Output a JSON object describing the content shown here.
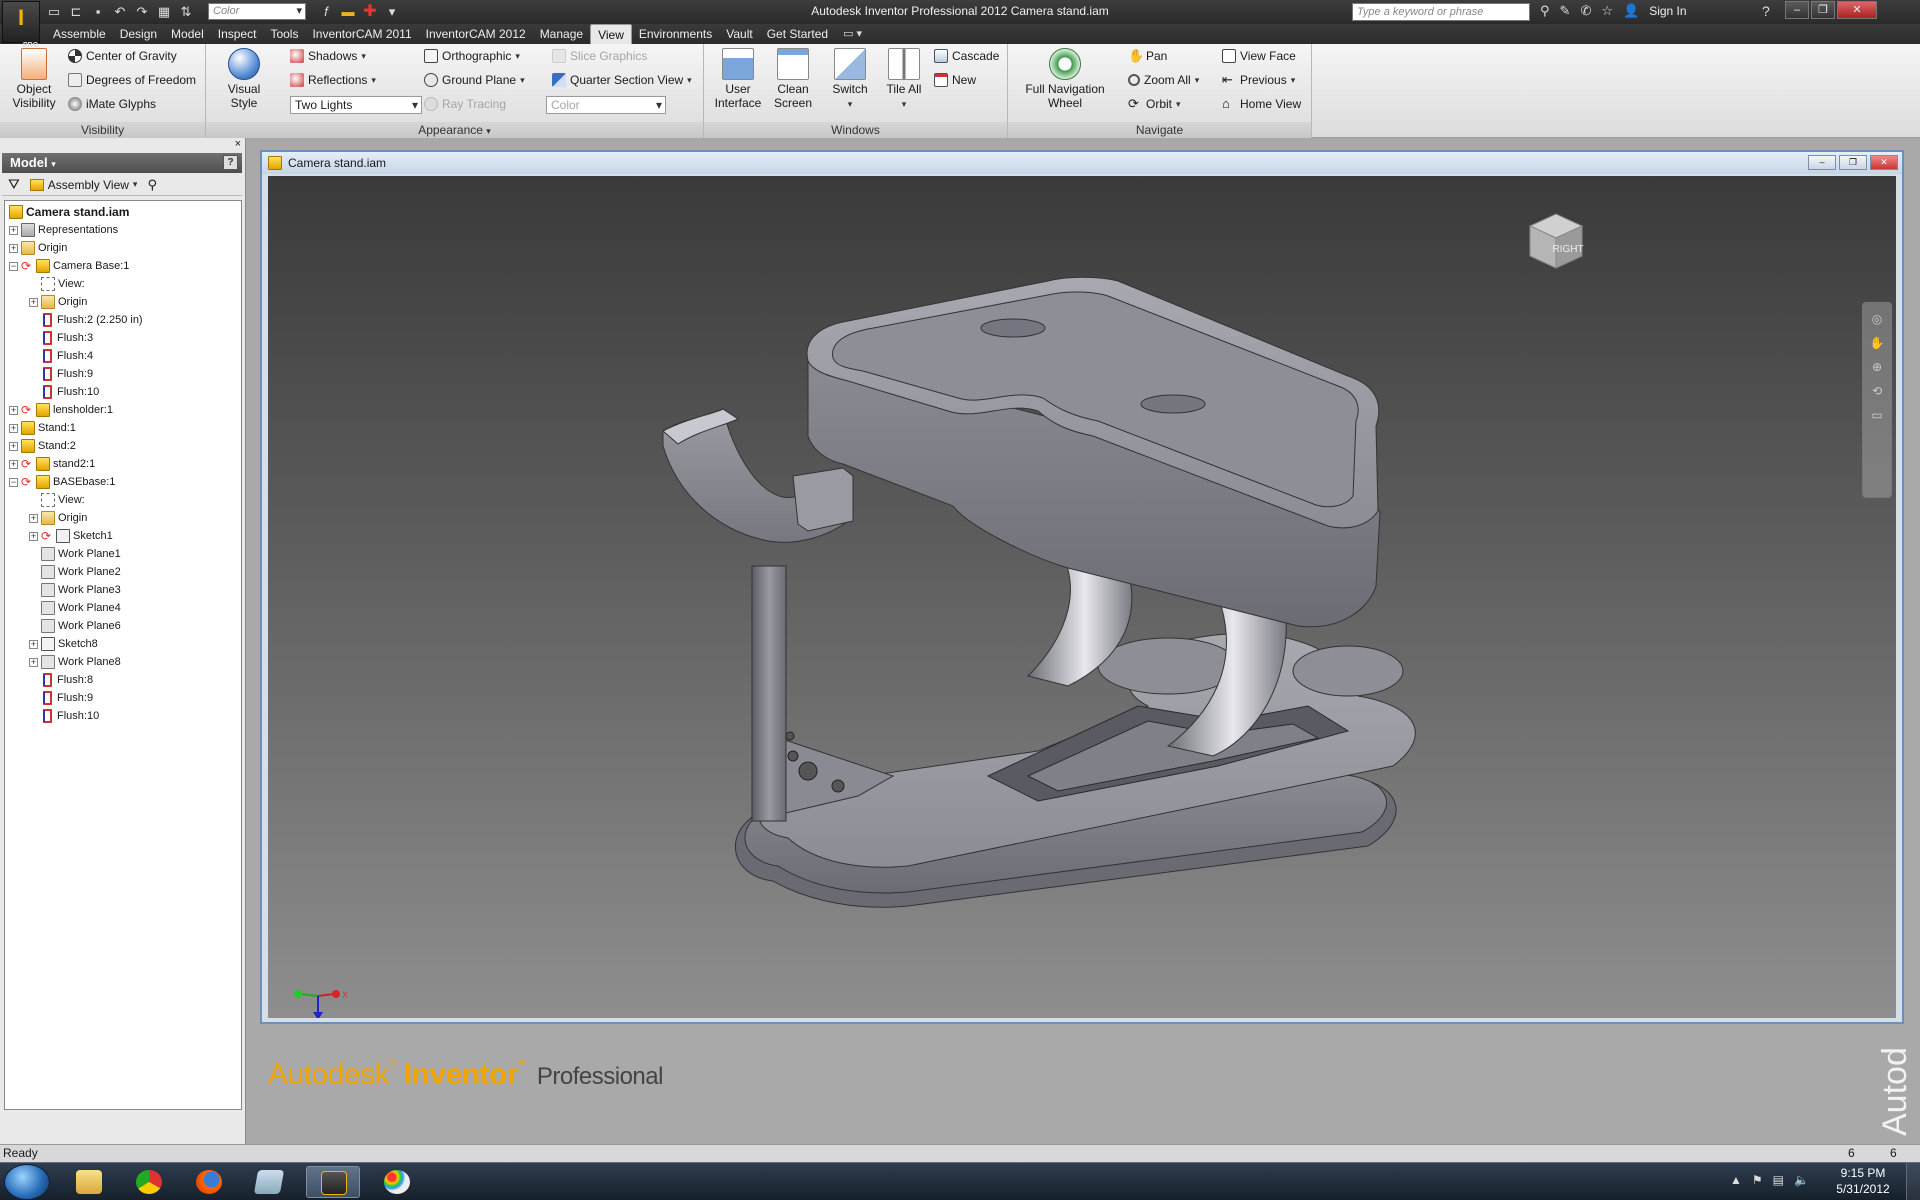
{
  "titlebar": {
    "title": "Autodesk Inventor Professional 2012    Camera stand.iam",
    "logo_text": "I",
    "logo_badge": "PRO",
    "qat_color": "Color",
    "search_placeholder": "Type a keyword or phrase",
    "sign_in": "Sign In"
  },
  "ribbon_tabs": [
    "Assemble",
    "Design",
    "Model",
    "Inspect",
    "Tools",
    "InventorCAM 2011",
    "InventorCAM 2012",
    "Manage",
    "View",
    "Environments",
    "Vault",
    "Get Started"
  ],
  "active_tab": "View",
  "ribbon": {
    "visibility": {
      "label": "Visibility",
      "object_visibility": "Object Visibility",
      "center_of_gravity": "Center of Gravity",
      "degrees_of_freedom": "Degrees of Freedom",
      "imate_glyphs": "iMate Glyphs"
    },
    "appearance": {
      "label": "Appearance",
      "visual_style": "Visual Style",
      "shadows": "Shadows",
      "reflections": "Reflections",
      "lighting": "Two Lights",
      "orthographic": "Orthographic",
      "ground_plane": "Ground Plane",
      "ray_tracing": "Ray Tracing",
      "slice_graphics": "Slice Graphics",
      "quarter_section_view": "Quarter Section View",
      "color": "Color"
    },
    "windows": {
      "label": "Windows",
      "user_interface": "User Interface",
      "clean_screen": "Clean Screen",
      "switch": "Switch",
      "tile_all": "Tile All",
      "cascade": "Cascade",
      "new": "New"
    },
    "navigate": {
      "label": "Navigate",
      "full_navigation_wheel": "Full Navigation Wheel",
      "pan": "Pan",
      "zoom_all": "Zoom All",
      "orbit": "Orbit",
      "view_face": "View Face",
      "previous": "Previous",
      "home_view": "Home View"
    }
  },
  "browser": {
    "header": "Model",
    "help": "?",
    "close": "×",
    "view_mode": "Assembly View",
    "tree": [
      {
        "label": "Camera stand.iam",
        "level": 0,
        "icon": "asm",
        "exp": ""
      },
      {
        "label": "Representations",
        "level": 0,
        "icon": "rep",
        "exp": "+"
      },
      {
        "label": "Origin",
        "level": 0,
        "icon": "folder",
        "exp": "+"
      },
      {
        "label": "Camera Base:1",
        "level": 0,
        "icon": "asm",
        "exp": "−",
        "cons": true
      },
      {
        "label": "View:",
        "level": 1,
        "icon": "view",
        "exp": ""
      },
      {
        "label": "Origin",
        "level": 1,
        "icon": "folder",
        "exp": "+"
      },
      {
        "label": "Flush:2 (2.250 in)",
        "level": 1,
        "icon": "flush",
        "exp": ""
      },
      {
        "label": "Flush:3",
        "level": 1,
        "icon": "flush",
        "exp": ""
      },
      {
        "label": "Flush:4",
        "level": 1,
        "icon": "flush",
        "exp": ""
      },
      {
        "label": "Flush:9",
        "level": 1,
        "icon": "flush",
        "exp": ""
      },
      {
        "label": "Flush:10",
        "level": 1,
        "icon": "flush",
        "exp": ""
      },
      {
        "label": "lensholder:1",
        "level": 0,
        "icon": "part",
        "exp": "+",
        "cons": true
      },
      {
        "label": "Stand:1",
        "level": 0,
        "icon": "part",
        "exp": "+"
      },
      {
        "label": "Stand:2",
        "level": 0,
        "icon": "part",
        "exp": "+"
      },
      {
        "label": "stand2:1",
        "level": 0,
        "icon": "part",
        "exp": "+",
        "cons": true
      },
      {
        "label": "BASEbase:1",
        "level": 0,
        "icon": "asm",
        "exp": "−",
        "cons": true
      },
      {
        "label": "View:",
        "level": 1,
        "icon": "view",
        "exp": ""
      },
      {
        "label": "Origin",
        "level": 1,
        "icon": "folder",
        "exp": "+"
      },
      {
        "label": "Sketch1",
        "level": 1,
        "icon": "sketch",
        "exp": "+",
        "cons": true
      },
      {
        "label": "Work Plane1",
        "level": 1,
        "icon": "plane",
        "exp": ""
      },
      {
        "label": "Work Plane2",
        "level": 1,
        "icon": "plane",
        "exp": ""
      },
      {
        "label": "Work Plane3",
        "level": 1,
        "icon": "plane",
        "exp": ""
      },
      {
        "label": "Work Plane4",
        "level": 1,
        "icon": "plane",
        "exp": ""
      },
      {
        "label": "Work Plane6",
        "level": 1,
        "icon": "plane",
        "exp": ""
      },
      {
        "label": "Sketch8",
        "level": 1,
        "icon": "sketch",
        "exp": "+"
      },
      {
        "label": "Work Plane8",
        "level": 1,
        "icon": "plane",
        "exp": "+"
      },
      {
        "label": "Flush:8",
        "level": 1,
        "icon": "flush",
        "exp": ""
      },
      {
        "label": "Flush:9",
        "level": 1,
        "icon": "flush",
        "exp": ""
      },
      {
        "label": "Flush:10",
        "level": 1,
        "icon": "flush",
        "exp": ""
      }
    ]
  },
  "document": {
    "title": "Camera stand.iam",
    "viewcube_label": "RIGHT",
    "triad_x": "X",
    "triad_z": "Z"
  },
  "brand": {
    "autodesk": "Autodesk",
    "reg1": "®",
    "inventor": "Inventor",
    "reg2": "®",
    "professional": "Professional",
    "edge_text": "Autod"
  },
  "status": {
    "text": "Ready",
    "num1": "6",
    "num2": "6"
  },
  "taskbar": {
    "time": "9:15 PM",
    "date": "5/31/2012"
  },
  "icons": {
    "start": "windows-start-icon",
    "explorer": "folder-icon",
    "chrome": "chrome-icon",
    "firefox": "firefox-icon",
    "notepad": "notepad-icon",
    "inventor": "inventor-icon",
    "paint": "paint-icon"
  }
}
